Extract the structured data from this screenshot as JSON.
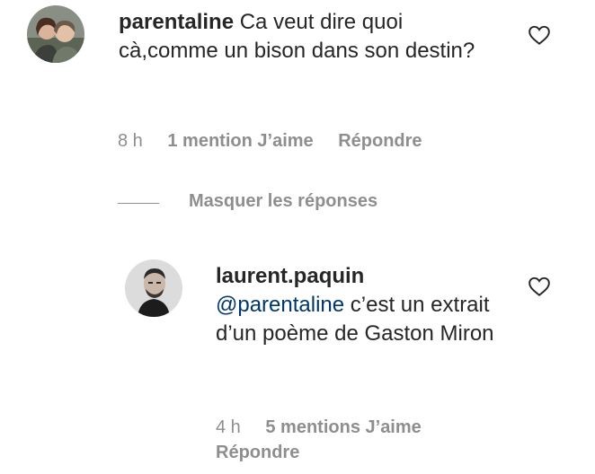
{
  "comments": [
    {
      "username": "parentaline",
      "text": "Ca veut dire quoi cà,comme un bison dans son destin?",
      "time": "8 h",
      "likes": "1 mention J’aime",
      "reply": "Répondre"
    }
  ],
  "replies_toggle": "Masquer les réponses",
  "reply": {
    "username": "laurent.paquin",
    "mention": "@parentaline",
    "text": " c’est un extrait d’un poème de Gaston Miron",
    "time": "4 h",
    "likes": "5 mentions J’aime",
    "reply": "Répondre"
  },
  "icons": {
    "like": "heart-outline-icon"
  }
}
